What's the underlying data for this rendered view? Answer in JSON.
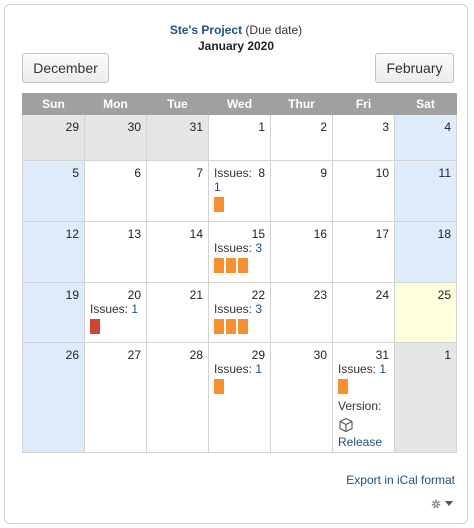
{
  "header": {
    "project": "Ste's Project",
    "mode": "(Due date)",
    "month": "January 2020"
  },
  "nav": {
    "prev": "December",
    "next": "February"
  },
  "weekdays": [
    "Sun",
    "Mon",
    "Tue",
    "Wed",
    "Thur",
    "Fri",
    "Sat"
  ],
  "cells": {
    "d29p": "29",
    "d30p": "30",
    "d31p": "31",
    "d1": "1",
    "d2": "2",
    "d3": "3",
    "d4": "4",
    "d5": "5",
    "d6": "6",
    "d7": "7",
    "d8": "8",
    "d9": "9",
    "d10": "10",
    "d11": "11",
    "d12": "12",
    "d13": "13",
    "d14": "14",
    "d15": "15",
    "d16": "16",
    "d17": "17",
    "d18": "18",
    "d19": "19",
    "d20": "20",
    "d21": "21",
    "d22": "22",
    "d23": "23",
    "d24": "24",
    "d25": "25",
    "d26": "26",
    "d27": "27",
    "d28": "28",
    "d29": "29",
    "d30": "30",
    "d31": "31",
    "d1n": "1"
  },
  "issues": {
    "label": "Issues:",
    "d8": "1",
    "d15": "3",
    "d20": "1",
    "d22": "3",
    "d29": "1",
    "d31": "1"
  },
  "version": {
    "label": "Version:",
    "name": "Release"
  },
  "colors": {
    "orange": "#f7912f",
    "red": "#d04437",
    "link": "#205081"
  },
  "footer": {
    "export": "Export in iCal format"
  },
  "icons": {
    "settings": "gear-icon",
    "version": "cube-icon"
  }
}
